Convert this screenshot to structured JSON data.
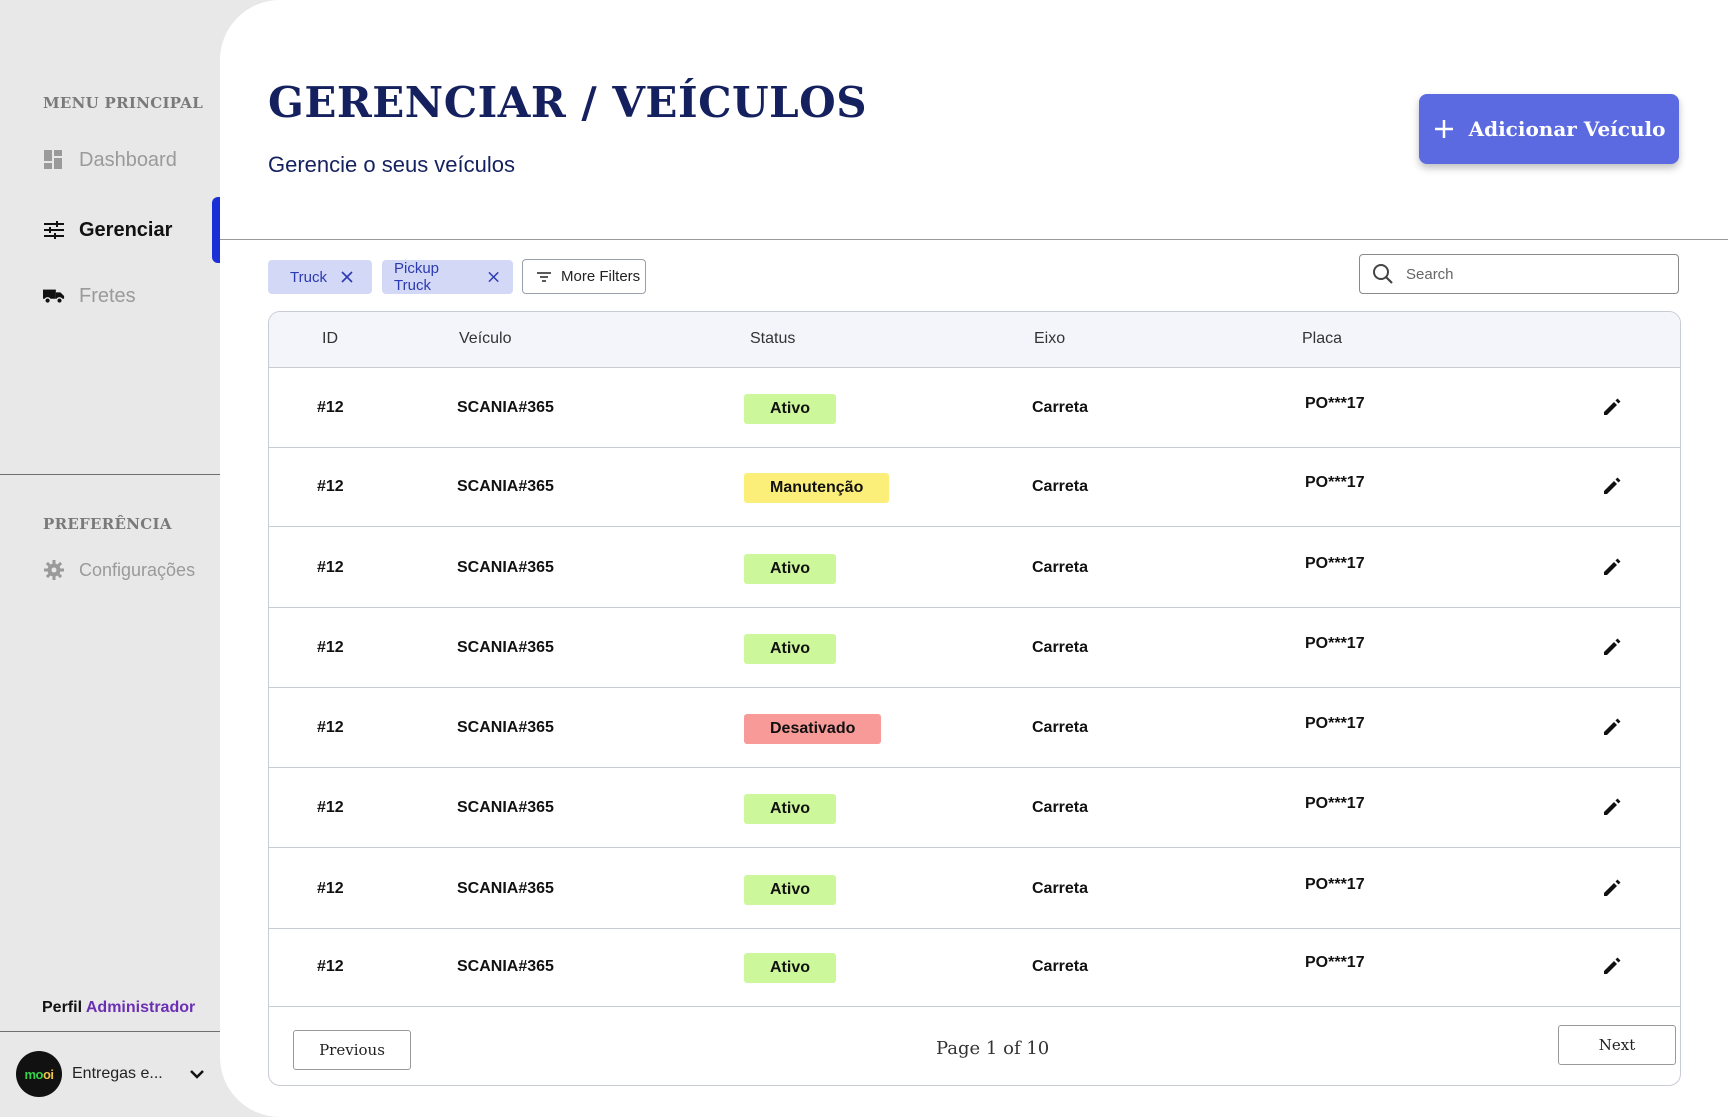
{
  "sidebar": {
    "menu_title": "MENU PRINCIPAL",
    "items": [
      {
        "label": "Dashboard",
        "icon": "dashboard-icon"
      },
      {
        "label": "Gerenciar",
        "icon": "tune-icon"
      },
      {
        "label": "Fretes",
        "icon": "truck-icon"
      }
    ],
    "active_item": "Gerenciar",
    "preference_title": "PREFERÊNCIA",
    "settings_label": "Configurações",
    "profile_prefix": "Perfil",
    "profile_role": "Administrador",
    "company_name": "Entregas e...",
    "company_logo_text_1": "mo",
    "company_logo_text_2": "oi"
  },
  "header": {
    "title": "GERENCIAR / VEÍCULOS",
    "subtitle": "Gerencie o seus veículos",
    "add_button_label": "Adicionar Veículo"
  },
  "filters": {
    "chips": [
      "Truck",
      "Pickup Truck"
    ],
    "more_filters_label": "More Filters",
    "search_placeholder": "Search"
  },
  "table": {
    "columns": [
      "ID",
      "Veículo",
      "Status",
      "Eixo",
      "Placa"
    ],
    "rows": [
      {
        "id": "#12",
        "veiculo": "SCANIA#365",
        "status": "Ativo",
        "eixo": "Carreta",
        "placa": "PO***17"
      },
      {
        "id": "#12",
        "veiculo": "SCANIA#365",
        "status": "Manutenção",
        "eixo": "Carreta",
        "placa": "PO***17"
      },
      {
        "id": "#12",
        "veiculo": "SCANIA#365",
        "status": "Ativo",
        "eixo": "Carreta",
        "placa": "PO***17"
      },
      {
        "id": "#12",
        "veiculo": "SCANIA#365",
        "status": "Ativo",
        "eixo": "Carreta",
        "placa": "PO***17"
      },
      {
        "id": "#12",
        "veiculo": "SCANIA#365",
        "status": "Desativado",
        "eixo": "Carreta",
        "placa": "PO***17"
      },
      {
        "id": "#12",
        "veiculo": "SCANIA#365",
        "status": "Ativo",
        "eixo": "Carreta",
        "placa": "PO***17"
      },
      {
        "id": "#12",
        "veiculo": "SCANIA#365",
        "status": "Ativo",
        "eixo": "Carreta",
        "placa": "PO***17"
      },
      {
        "id": "#12",
        "veiculo": "SCANIA#365",
        "status": "Ativo",
        "eixo": "Carreta",
        "placa": "PO***17"
      }
    ],
    "status_colors": {
      "Ativo": "#ccf79a",
      "Manutenção": "#fbef7a",
      "Desativado": "#f79a98"
    }
  },
  "pagination": {
    "previous_label": "Previous",
    "next_label": "Next",
    "page_info": "Page 1 of 10"
  },
  "colors": {
    "accent": "#5b6ae0",
    "active_indicator": "#1a2fd6",
    "title": "#14215e"
  }
}
